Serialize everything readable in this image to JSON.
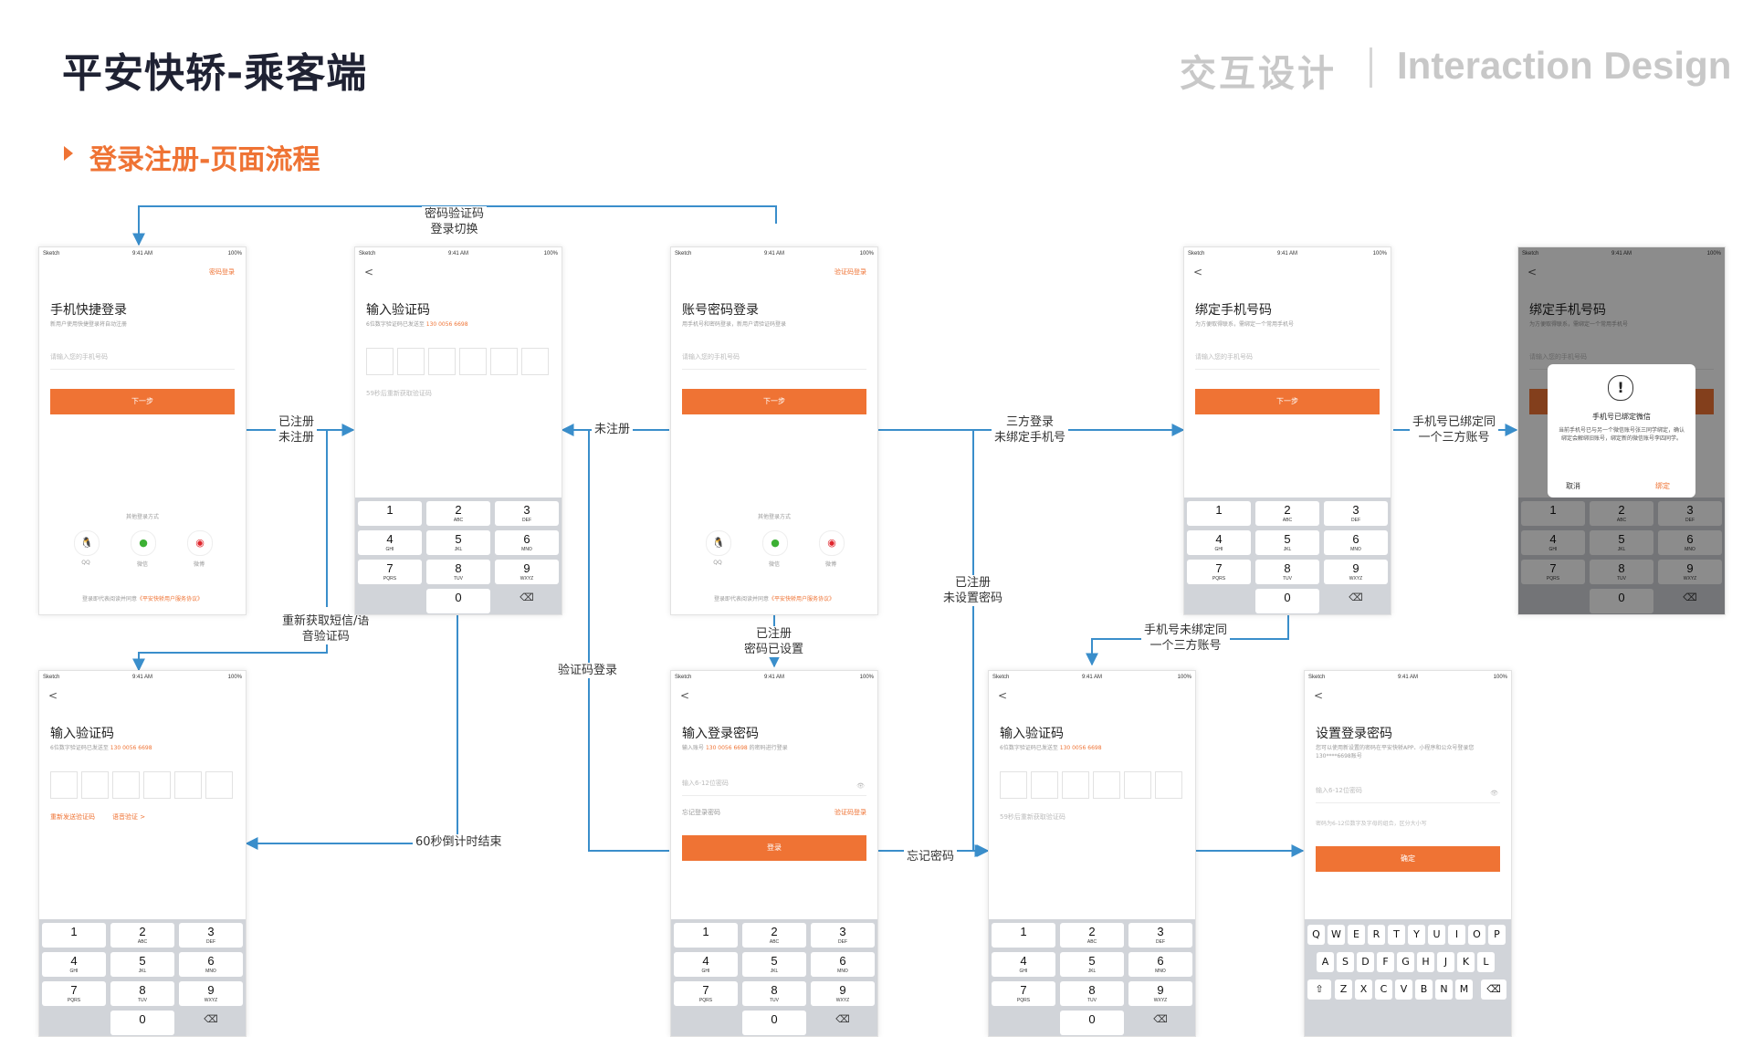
{
  "header": {
    "title": "平安快轿-乘客端",
    "category_cn": "交互设计",
    "category_en": "Interaction Design",
    "section": "登录注册-页面流程"
  },
  "status": {
    "carrier": "Sketch",
    "time": "9:41 AM",
    "battery": "100%"
  },
  "screens": {
    "quick_login": {
      "top_link": "密码登录",
      "title": "手机快捷登录",
      "sub": "新用户使用快捷登录将自动注册",
      "placeholder": "请输入您的手机号码",
      "button": "下一步",
      "other": "其他登录方式",
      "social": [
        "QQ",
        "微信",
        "微博"
      ],
      "agree": "登录即代表阅读并同意",
      "agree_link": "《平安快轿用户服务协议》"
    },
    "verify_top": {
      "title": "输入验证码",
      "sub": "6位数字验证码已发送至",
      "phone": "130 0056 6698",
      "resend": "59秒后重新获取验证码"
    },
    "pwd_login": {
      "top_link": "验证码登录",
      "title": "账号密码登录",
      "sub": "用手机号和密码登录，新用户请验证码登录",
      "placeholder": "请输入您的手机号码",
      "button": "下一步",
      "other": "其他登录方式",
      "social": [
        "QQ",
        "微信",
        "微博"
      ],
      "agree": "登录即代表阅读并同意",
      "agree_link": "《平安快轿用户服务协议》"
    },
    "bind_phone": {
      "title": "绑定手机号码",
      "sub": "为方便取得联系，需绑定一个常用手机号",
      "placeholder": "请输入您的手机号码",
      "button": "下一步"
    },
    "bind_dialog": {
      "title": "绑定手机号码",
      "sub": "为方便取得联系，需绑定一个常用手机号",
      "placeholder": "请输入您的手机号码",
      "icon": "!",
      "dlg_title": "手机号已绑定微信",
      "dlg_body": "当前手机号已与另一个微信账号张三同学绑定，确认绑定会解绑旧账号，绑定新的微信账号李四同学。",
      "cancel": "取消",
      "confirm": "绑定"
    },
    "verify_voice": {
      "title": "输入验证码",
      "sub": "6位数字验证码已发送至",
      "phone": "130 0056 6698",
      "resend": "重新发送验证码",
      "voice": "语音验证 >"
    },
    "enter_pwd": {
      "title": "输入登录密码",
      "sub_pre": "输入账号",
      "phone": "130 0056 6698",
      "sub_post": "的密码进行登录",
      "placeholder": "输入6-12位密码",
      "forgot": "忘记登录密码",
      "code_login": "验证码登录",
      "button": "登录"
    },
    "verify_bottom": {
      "title": "输入验证码",
      "sub": "6位数字验证码已发送至",
      "phone": "130 0056 6698",
      "resend": "59秒后重新获取验证码"
    },
    "set_pwd": {
      "title": "设置登录密码",
      "sub": "您可以使用新设置的密码在平安快轿APP、小程序和公众号登录您130****6698账号",
      "placeholder": "输入6-12位密码",
      "hint": "密码为6-12位数字及字母的组合，区分大小写",
      "button": "确定"
    }
  },
  "keypad": [
    {
      "d": "1",
      "s": ""
    },
    {
      "d": "2",
      "s": "ABC"
    },
    {
      "d": "3",
      "s": "DEF"
    },
    {
      "d": "4",
      "s": "GHI"
    },
    {
      "d": "5",
      "s": "JKL"
    },
    {
      "d": "6",
      "s": "MNO"
    },
    {
      "d": "7",
      "s": "PQRS"
    },
    {
      "d": "8",
      "s": "TUV"
    },
    {
      "d": "9",
      "s": "WXYZ"
    },
    {
      "d": "0",
      "s": ""
    }
  ],
  "qwerty": {
    "row1": [
      "Q",
      "W",
      "E",
      "R",
      "T",
      "Y",
      "U",
      "I",
      "O",
      "P"
    ],
    "row2": [
      "A",
      "S",
      "D",
      "F",
      "G",
      "H",
      "J",
      "K",
      "L"
    ],
    "row3": [
      "Z",
      "X",
      "C",
      "V",
      "B",
      "N",
      "M"
    ]
  },
  "flow_labels": {
    "switch": "密码验证码\n登录切换",
    "reg_unreg": "已注册\n未注册",
    "unregistered": "未注册",
    "third_party": "三方登录\n未绑定手机号",
    "bound_same": "手机号已绑定同\n一个三方账号",
    "resend": "重新获取短信/语\n音验证码",
    "registered_pwd": "已注册\n密码已设置",
    "code_login": "验证码登录",
    "registered_nopwd": "已注册\n未设置密码",
    "not_bound": "手机号未绑定同\n一个三方账号",
    "countdown": "60秒倒计时结束",
    "forgot": "忘记密码"
  },
  "colors": {
    "accent": "#ef7334",
    "flow": "#3a8ecb",
    "title": "#1f2233"
  }
}
